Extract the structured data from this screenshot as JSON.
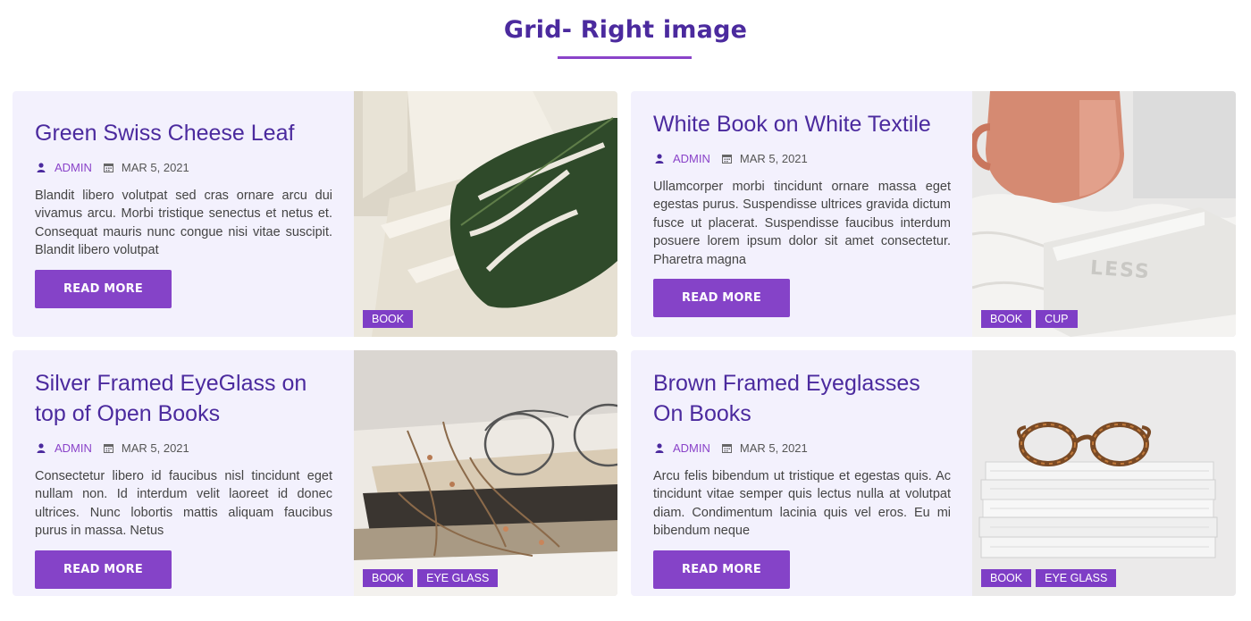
{
  "section": {
    "title": "Grid- Right image"
  },
  "colors": {
    "title": "#4b2a9e",
    "accent": "#8543c8",
    "card_bg": "#f3f1fd"
  },
  "posts": [
    {
      "title": "Green Swiss Cheese Leaf",
      "author": "ADMIN",
      "date": "MAR 5, 2021",
      "excerpt": "Blandit libero volutpat sed cras ornare arcu dui vivamus arcu. Morbi tristique senectus et netus et. Consequat mauris nunc congue nisi vitae suscipit. Blandit libero volutpat",
      "button": "READ MORE",
      "tags": [
        "BOOK"
      ],
      "icons": {
        "author": "user-icon",
        "date": "calendar-icon"
      }
    },
    {
      "title": "White Book on White Textile",
      "author": "ADMIN",
      "date": "MAR 5, 2021",
      "excerpt": "Ullamcorper morbi tincidunt ornare massa eget egestas purus. Suspendisse ultrices gravida dictum fusce ut placerat. Suspendisse faucibus interdum posuere lorem ipsum dolor sit amet consectetur. Pharetra magna",
      "button": "READ MORE",
      "tags": [
        "BOOK",
        "CUP"
      ],
      "image_text": "LESS",
      "icons": {
        "author": "user-icon",
        "date": "calendar-icon"
      }
    },
    {
      "title": "Silver Framed EyeGlass on top of Open Books",
      "author": "ADMIN",
      "date": "MAR 5, 2021",
      "excerpt": "Consectetur libero id faucibus nisl tincidunt eget nullam non. Id interdum velit laoreet id donec ultrices. Nunc lobortis mattis aliquam faucibus purus in massa. Netus",
      "button": "READ MORE",
      "tags": [
        "BOOK",
        "EYE GLASS"
      ],
      "icons": {
        "author": "user-icon",
        "date": "calendar-icon"
      }
    },
    {
      "title": "Brown Framed Eyeglasses On Books",
      "author": "ADMIN",
      "date": "MAR 5, 2021",
      "excerpt": "Arcu felis bibendum ut tristique et egestas quis. Ac tincidunt vitae semper quis lectus nulla at volutpat diam. Condimentum lacinia quis vel eros. Eu mi bibendum neque",
      "button": "READ MORE",
      "tags": [
        "BOOK",
        "EYE GLASS"
      ],
      "icons": {
        "author": "user-icon",
        "date": "calendar-icon"
      }
    }
  ]
}
